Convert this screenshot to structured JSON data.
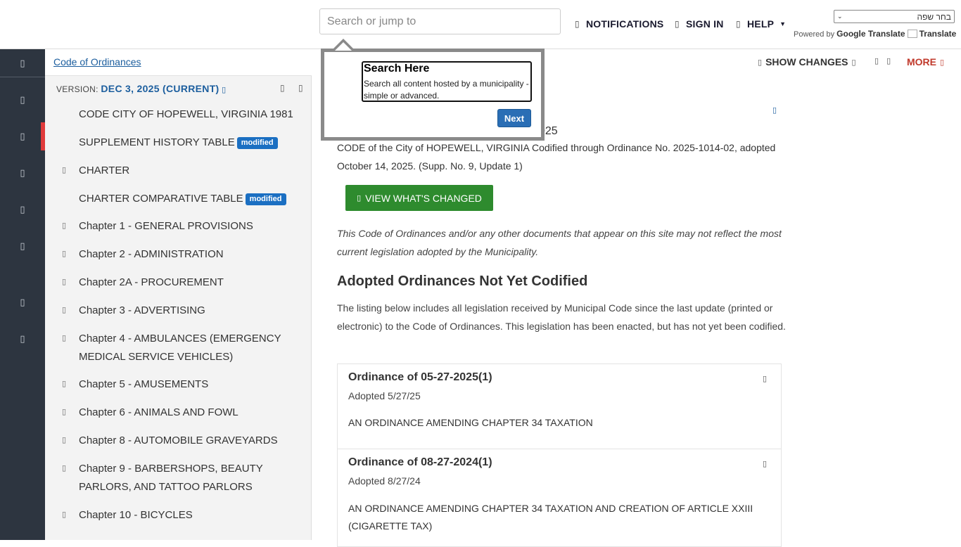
{
  "header": {
    "search_placeholder": "Search or jump to",
    "notifications": "NOTIFICATIONS",
    "sign_in": "SIGN IN",
    "help": "HELP",
    "language_select": "בחר שפה",
    "powered_by": "Powered by",
    "google_translate": "Google Translate",
    "translate": "Translate"
  },
  "icons": {
    "rail": [
      "menu-icon",
      "book-icon",
      "search-icon",
      "compare-icon",
      "clock-icon",
      "bookmark-icon",
      "print-icon",
      "help-icon"
    ],
    "glyph": "▯"
  },
  "toc": {
    "breadcrumb": "Code of Ordinances",
    "version_label": "VERSION:",
    "version_value": "DEC 3, 2025 (CURRENT)",
    "items": [
      {
        "label": "CODE CITY OF HOPEWELL, VIRGINIA 1981"
      },
      {
        "label": "SUPPLEMENT HISTORY TABLE",
        "badge": "modified"
      },
      {
        "label": "CHARTER"
      },
      {
        "label": "CHARTER COMPARATIVE TABLE",
        "badge": "modified"
      },
      {
        "label": "Chapter 1 - GENERAL PROVISIONS"
      },
      {
        "label": "Chapter 2 - ADMINISTRATION"
      },
      {
        "label": "Chapter 2A - PROCUREMENT"
      },
      {
        "label": "Chapter 3 - ADVERTISING"
      },
      {
        "label": "Chapter 4 - AMBULANCES (EMERGENCY MEDICAL SERVICE VEHICLES)"
      },
      {
        "label": "Chapter 5 - AMUSEMENTS"
      },
      {
        "label": "Chapter 6 - ANIMALS AND FOWL"
      },
      {
        "label": "Chapter 8 - AUTOMOBILE GRAVEYARDS"
      },
      {
        "label": "Chapter 9 - BARBERSHOPS, BEAUTY PARLORS, AND TATTOO PARLORS"
      },
      {
        "label": "Chapter 10 - BICYCLES"
      }
    ]
  },
  "toolbar": {
    "show_changes": "SHOW CHANGES",
    "more": "MORE"
  },
  "content": {
    "partial_date": "025",
    "codified": "CODE of the City of HOPEWELL, VIRGINIA Codified through Ordinance No. 2025-1014-02, adopted October 14, 2025. (Supp. No. 9, Update 1)",
    "view_changes": "VIEW WHAT'S CHANGED",
    "disclaimer": "This Code of Ordinances and/or any other documents that appear on this site may not reflect the most current legislation adopted by the Municipality.",
    "adopted_heading": "Adopted Ordinances Not Yet Codified",
    "listing_text": "The listing below includes all legislation received by Municipal Code since the last update (printed or electronic) to the Code of Ordinances. This legislation has been enacted, but has not yet been codified.",
    "ordinances": [
      {
        "title": "Ordinance of 05-27-2025(1)",
        "adopted": "Adopted 5/27/25",
        "desc": "AN ORDINANCE AMENDING CHAPTER 34 TAXATION"
      },
      {
        "title": "Ordinance of 08-27-2024(1)",
        "adopted": "Adopted 8/27/24",
        "desc": "AN ORDINANCE AMENDING CHAPTER 34 TAXATION AND CREATION OF ARTICLE XXIII (CIGARETTE TAX)"
      }
    ]
  },
  "tour": {
    "title": "Search Here",
    "body": "Search all content hosted by a municipality - simple or advanced.",
    "next": "Next"
  },
  "colors": {
    "rail": "#2d3540",
    "accent_blue": "#1c5e9e",
    "green_button": "#2e8b2e",
    "more_red": "#c0392b",
    "badge_blue": "#1b6fc2"
  }
}
